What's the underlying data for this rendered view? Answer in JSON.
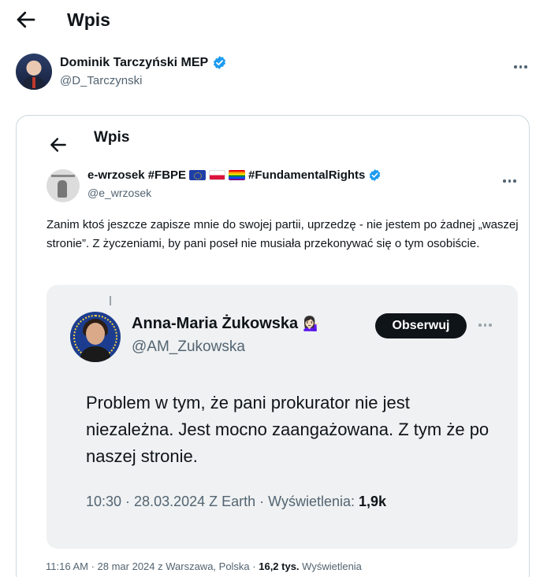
{
  "header": {
    "title": "Wpis"
  },
  "author": {
    "name": "Dominik Tarczyński MEP",
    "handle": "@D_Tarczynski"
  },
  "embed": {
    "title": "Wpis",
    "author": {
      "name": "e-wrzosek #FBPE",
      "tag": "#FundamentalRights",
      "handle": "@e_wrzosek"
    },
    "text": "Zanim ktoś jeszcze zapisze mnie do swojej partii, uprzedzę - nie jestem po żadnej „waszej stronie”. Z życzeniami, by pani poseł nie musiała przekonywać się o tym osobiście.",
    "quote": {
      "name": "Anna-Maria Żukowska",
      "emoji": "💁🏻‍♀️",
      "handle": "@AM_Zukowska",
      "follow_label": "Obserwuj",
      "text": "Problem w tym, że pani prokurator nie jest niezależna. Jest mocno zaangażowana. Z tym że po naszej stronie.",
      "meta_prefix": "10:30 · 28.03.2024 Z Earth · Wyświetlenia: ",
      "views": "1,9k"
    },
    "footer": {
      "prefix": "11:16 AM · 28 mar 2024 z Warszawa, Polska · ",
      "views": "16,2 tys.",
      "suffix": " Wyświetlenia"
    }
  },
  "colors": {
    "verified": "#1d9bf0",
    "text": "#0f1419",
    "muted": "#536471"
  },
  "icons": [
    "back-arrow-icon",
    "more-icon",
    "verified-badge-icon",
    "flag-eu-icon",
    "flag-poland-icon",
    "flag-rainbow-icon"
  ]
}
